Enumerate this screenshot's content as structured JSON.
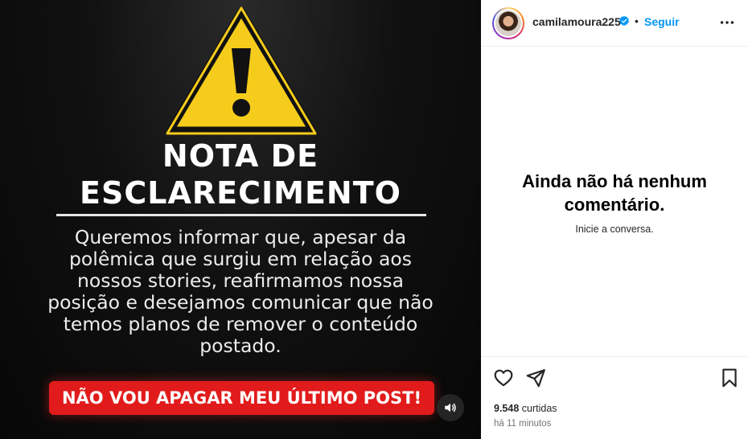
{
  "media": {
    "title_line1": "NOTA DE",
    "title_line2": "ESCLARECIMENTO",
    "body_lines": [
      "Queremos informar que, apesar da",
      "polêmica que surgiu em relação aos",
      "nossos stories, reafirmamos nossa",
      "posição e desejamos comunicar que não",
      "temos planos de remover o conteúdo",
      "postado."
    ],
    "banner": "NÃO VOU APAGAR MEU ÚLTIMO POST!",
    "warning_icon": "warning-triangle-icon",
    "audio_icon": "speaker-icon"
  },
  "post": {
    "username": "camilamoura225",
    "verified_icon": "verified-badge-icon",
    "separator": "•",
    "follow_label": "Seguir",
    "more_icon": "more-options-icon"
  },
  "comments": {
    "empty_title": "Ainda não há nenhum comentário.",
    "empty_subtitle": "Inicie a conversa."
  },
  "actions": {
    "like_icon": "heart-icon",
    "share_icon": "send-icon",
    "save_icon": "bookmark-icon"
  },
  "stats": {
    "likes_count": "9.548",
    "likes_label": " curtidas",
    "time_ago": "há 11 minutos"
  },
  "colors": {
    "accent": "#0095f6",
    "banner_red": "#e11b1b",
    "warning_yellow": "#f5cc1b"
  }
}
